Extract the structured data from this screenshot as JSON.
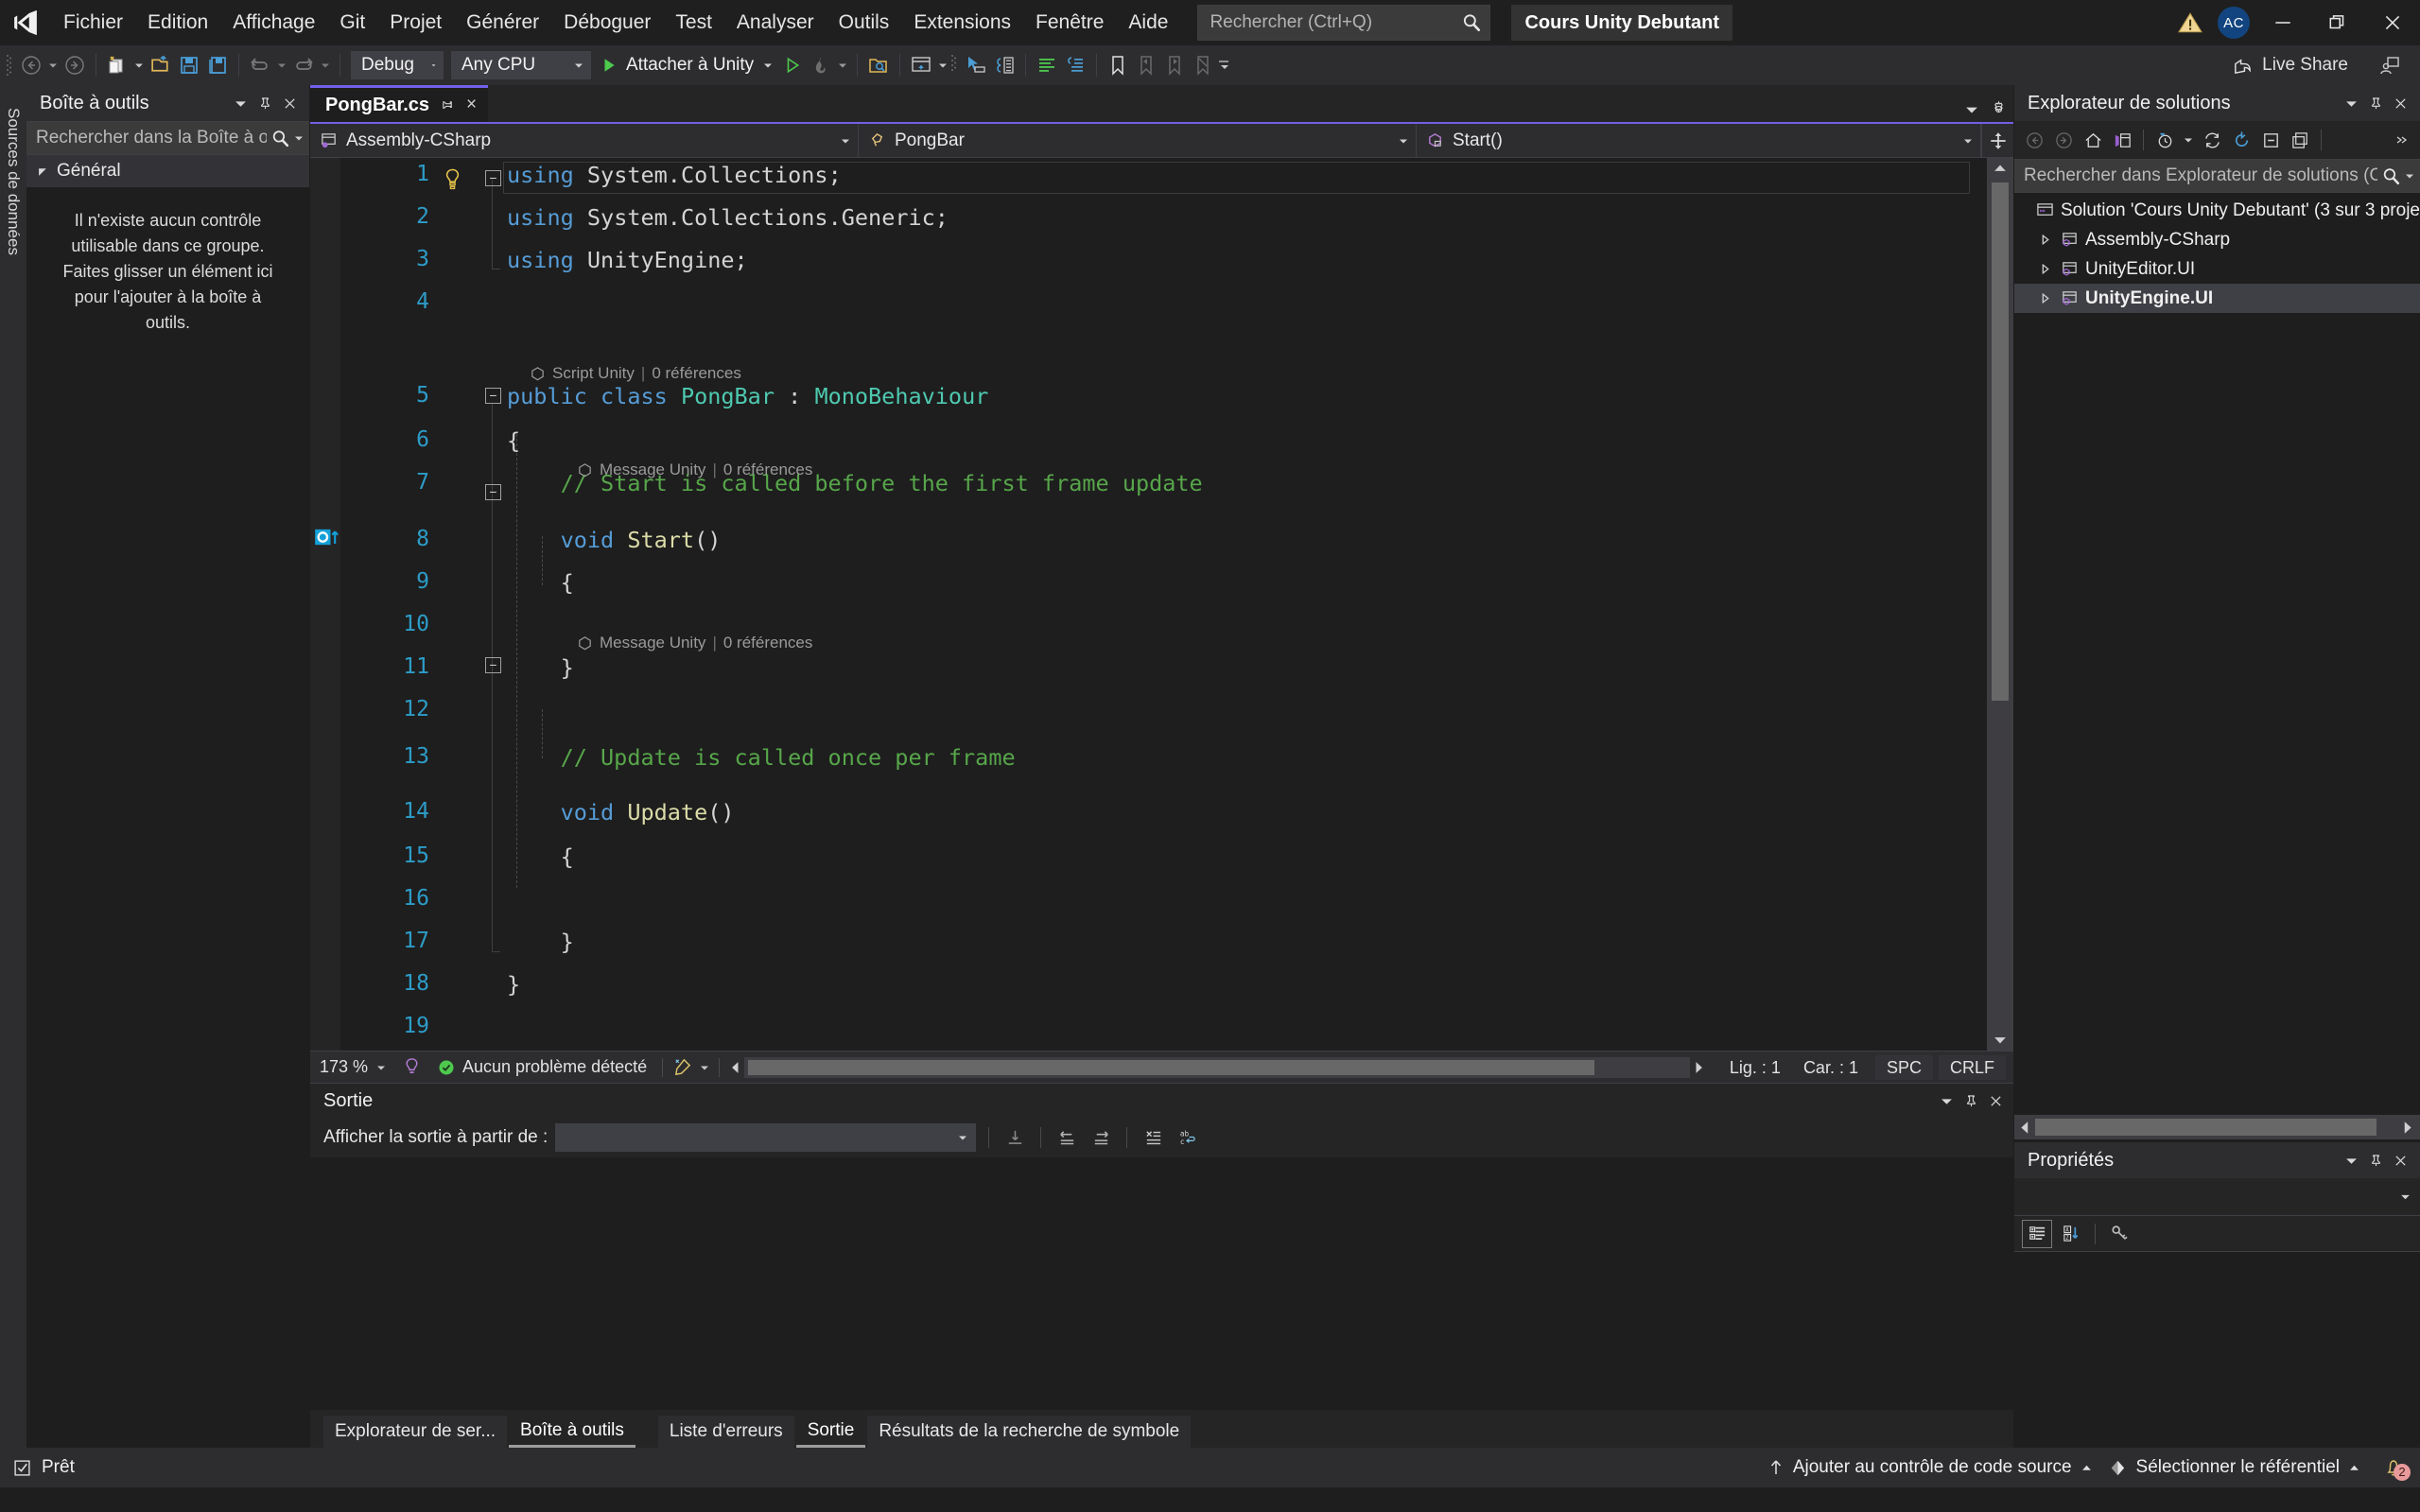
{
  "titlebar": {
    "menu": [
      "Fichier",
      "Edition",
      "Affichage",
      "Git",
      "Projet",
      "Générer",
      "Déboguer",
      "Test",
      "Analyser",
      "Outils",
      "Extensions",
      "Fenêtre",
      "Aide"
    ],
    "search_placeholder": "Rechercher (Ctrl+Q)",
    "solution_name": "Cours Unity Debutant",
    "avatar_initials": "AC"
  },
  "toolbar": {
    "configuration": "Debug",
    "platform": "Any CPU",
    "run_label": "Attacher à Unity",
    "live_share": "Live Share"
  },
  "left_dock": {
    "vertical_tab": "Sources de données",
    "toolbox": {
      "title": "Boîte à outils",
      "search_placeholder": "Rechercher dans la Boîte à ou",
      "group": "Général",
      "empty_text": "Il n'existe aucun contrôle utilisable dans ce groupe. Faites glisser un élément ici pour l'ajouter à la boîte à outils."
    }
  },
  "editor": {
    "tab_name": "PongBar.cs",
    "nav": {
      "project": "Assembly-CSharp",
      "type": "PongBar",
      "member": "Start()"
    },
    "lines": [
      {
        "n": "1",
        "tokens": [
          {
            "t": "using",
            "c": "k"
          },
          {
            "t": " System",
            "c": "p"
          },
          {
            "t": ".",
            "c": "p"
          },
          {
            "t": "Collections",
            "c": "p"
          },
          {
            "t": ";",
            "c": "p"
          }
        ]
      },
      {
        "n": "2",
        "tokens": [
          {
            "t": "using",
            "c": "k"
          },
          {
            "t": " System",
            "c": "p"
          },
          {
            "t": ".",
            "c": "p"
          },
          {
            "t": "Collections",
            "c": "p"
          },
          {
            "t": ".",
            "c": "p"
          },
          {
            "t": "Generic",
            "c": "p"
          },
          {
            "t": ";",
            "c": "p"
          }
        ]
      },
      {
        "n": "3",
        "tokens": [
          {
            "t": "using",
            "c": "k"
          },
          {
            "t": " UnityEngine",
            "c": "p"
          },
          {
            "t": ";",
            "c": "p"
          }
        ]
      },
      {
        "n": "4",
        "tokens": []
      },
      {
        "n": "5",
        "tokens": [
          {
            "t": "public class ",
            "c": "k"
          },
          {
            "t": "PongBar",
            "c": "t"
          },
          {
            "t": " : ",
            "c": "p"
          },
          {
            "t": "MonoBehaviour",
            "c": "t"
          }
        ]
      },
      {
        "n": "6",
        "tokens": [
          {
            "t": "{",
            "c": "p"
          }
        ]
      },
      {
        "n": "7",
        "tokens": [
          {
            "t": "    // Start is called before the first frame update",
            "c": "c"
          }
        ]
      },
      {
        "n": "8",
        "tokens": [
          {
            "t": "    ",
            "c": "p"
          },
          {
            "t": "void ",
            "c": "k"
          },
          {
            "t": "Start",
            "c": "m"
          },
          {
            "t": "()",
            "c": "p"
          }
        ]
      },
      {
        "n": "9",
        "tokens": [
          {
            "t": "    {",
            "c": "p"
          }
        ]
      },
      {
        "n": "10",
        "tokens": []
      },
      {
        "n": "11",
        "tokens": [
          {
            "t": "    }",
            "c": "p"
          }
        ]
      },
      {
        "n": "12",
        "tokens": []
      },
      {
        "n": "13",
        "tokens": [
          {
            "t": "    // Update is called once per frame",
            "c": "c"
          }
        ]
      },
      {
        "n": "14",
        "tokens": [
          {
            "t": "    ",
            "c": "p"
          },
          {
            "t": "void ",
            "c": "k"
          },
          {
            "t": "Update",
            "c": "m"
          },
          {
            "t": "()",
            "c": "p"
          }
        ]
      },
      {
        "n": "15",
        "tokens": [
          {
            "t": "    {",
            "c": "p"
          }
        ]
      },
      {
        "n": "16",
        "tokens": []
      },
      {
        "n": "17",
        "tokens": [
          {
            "t": "    }",
            "c": "p"
          }
        ]
      },
      {
        "n": "18",
        "tokens": [
          {
            "t": "}",
            "c": "p"
          }
        ]
      },
      {
        "n": "19",
        "tokens": []
      }
    ],
    "codelens": [
      {
        "kind": "Script Unity",
        "refs": "0 références"
      },
      {
        "kind": "Message Unity",
        "refs": "0 références"
      },
      {
        "kind": "Message Unity",
        "refs": "0 références"
      }
    ],
    "status": {
      "zoom": "173 %",
      "problems": "Aucun problème détecté",
      "line": "Lig. : 1",
      "col": "Car. : 1",
      "spaces": "SPC",
      "eol": "CRLF"
    }
  },
  "output": {
    "title": "Sortie",
    "filter_label": "Afficher la sortie à partir de :",
    "filter_value": ""
  },
  "bottom_tabs_left": [
    {
      "label": "Explorateur de ser...",
      "active": false
    },
    {
      "label": "Boîte à outils",
      "active": true
    }
  ],
  "bottom_tabs_right": [
    {
      "label": "Liste d'erreurs",
      "active": false
    },
    {
      "label": "Sortie",
      "active": true
    },
    {
      "label": "Résultats de la recherche de symbole",
      "active": false
    }
  ],
  "solution_explorer": {
    "title": "Explorateur de solutions",
    "search_placeholder": "Rechercher dans Explorateur de solutions (Ct",
    "tree": [
      {
        "label": "Solution 'Cours Unity Debutant' (3 sur 3 proje",
        "indent": 0,
        "twist": false,
        "bold": false,
        "selected": false
      },
      {
        "label": "Assembly-CSharp",
        "indent": 1,
        "twist": true,
        "bold": false,
        "selected": false
      },
      {
        "label": "UnityEditor.UI",
        "indent": 1,
        "twist": true,
        "bold": false,
        "selected": false
      },
      {
        "label": "UnityEngine.UI",
        "indent": 1,
        "twist": true,
        "bold": true,
        "selected": true
      }
    ]
  },
  "properties": {
    "title": "Propriétés"
  },
  "statusbar": {
    "ready": "Prêt",
    "source_control": "Ajouter au contrôle de code source",
    "repository": "Sélectionner le référentiel",
    "notifications": "2"
  },
  "colors": {
    "accent_purple": "#7160e8",
    "keyword_blue": "#569cd6",
    "type_teal": "#4ec9b0",
    "comment_green": "#57a64a",
    "linenum_blue": "#2d9cc8",
    "panel_bg": "#252526",
    "editor_bg": "#1e1e1e"
  }
}
